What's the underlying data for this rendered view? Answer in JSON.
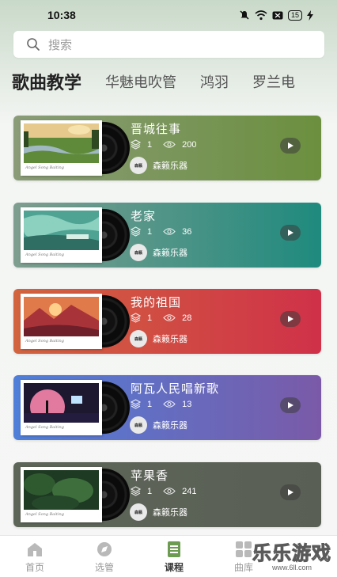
{
  "status": {
    "time": "10:38",
    "battery": "15",
    "icons": [
      "mute-icon",
      "wifi-icon",
      "sim-icon",
      "battery-icon",
      "charging-icon"
    ]
  },
  "search": {
    "placeholder": "搜索"
  },
  "categories": {
    "items": [
      {
        "label": "歌曲教学",
        "active": true
      },
      {
        "label": "华魅电吹管",
        "active": false
      },
      {
        "label": "鸿羽",
        "active": false
      },
      {
        "label": "罗兰电",
        "active": false
      }
    ]
  },
  "courses": [
    {
      "title": "晋城往事",
      "lessons": "1",
      "views": "200",
      "brand": "森籁乐器",
      "gradient": [
        "#8a9c78",
        "#6b8f3e"
      ]
    },
    {
      "title": "老家",
      "lessons": "1",
      "views": "36",
      "brand": "森籁乐器",
      "gradient": [
        "#7f9e90",
        "#1f8a7e"
      ]
    },
    {
      "title": "我的祖国",
      "lessons": "1",
      "views": "28",
      "brand": "森籁乐器",
      "gradient": [
        "#d2643f",
        "#cf3148"
      ]
    },
    {
      "title": "阿瓦人民唱新歌",
      "lessons": "1",
      "views": "13",
      "brand": "森籁乐器",
      "gradient": [
        "#4f7fd8",
        "#7a5aa8"
      ]
    },
    {
      "title": "苹果香",
      "lessons": "1",
      "views": "241",
      "brand": "森籁乐器",
      "gradient": [
        "#5d6558",
        "#5a5f55"
      ]
    }
  ],
  "cover_caption": "Angel Song Baiting",
  "brand_logo_text": "森籁",
  "bottom_nav": {
    "items": [
      {
        "label": "首页",
        "icon": "home-icon",
        "active": false
      },
      {
        "label": "选管",
        "icon": "compass-icon",
        "active": false
      },
      {
        "label": "课程",
        "icon": "course-list-icon",
        "active": true
      },
      {
        "label": "曲库",
        "icon": "library-grid-icon",
        "active": false
      }
    ]
  },
  "watermark": {
    "text": "乐乐游戏",
    "url": "www.6ll.com"
  }
}
